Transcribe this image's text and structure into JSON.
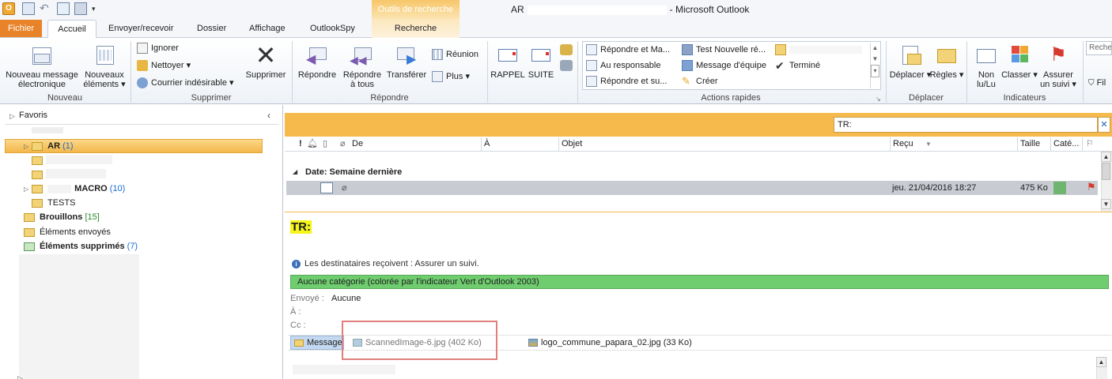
{
  "window": {
    "title_prefix": "AR",
    "title_suffix": "- Microsoft Outlook",
    "contextual_tab_group": "Outils de recherche"
  },
  "tabs": {
    "fichier": "Fichier",
    "accueil": "Accueil",
    "envoyer_recevoir": "Envoyer/recevoir",
    "dossier": "Dossier",
    "affichage": "Affichage",
    "outlookspy": "OutlookSpy",
    "recherche": "Recherche"
  },
  "ribbon": {
    "nouveau": {
      "label": "Nouveau",
      "new_email_l1": "Nouveau message",
      "new_email_l2": "électronique",
      "new_items_l1": "Nouveaux",
      "new_items_l2": "éléments ▾"
    },
    "supprimer": {
      "label": "Supprimer",
      "ignorer": "Ignorer",
      "nettoyer": "Nettoyer ▾",
      "courrier_indesirable": "Courrier indésirable ▾",
      "supprimer": "Supprimer"
    },
    "repondre": {
      "label": "Répondre",
      "repondre": "Répondre",
      "repondre_tous_l1": "Répondre",
      "repondre_tous_l2": "à tous",
      "transferer": "Transférer",
      "reunion": "Réunion",
      "plus": "Plus ▾"
    },
    "custom": {
      "rappel": "RAPPEL",
      "suite": "SUITE"
    },
    "actions_rapides": {
      "label": "Actions rapides",
      "items": [
        "Répondre et Ma...",
        "Au responsable",
        "Répondre et su...",
        "Test Nouvelle ré...",
        "Message d'équipe",
        "Créer",
        "Terminé"
      ]
    },
    "deplacer": {
      "label": "Déplacer",
      "deplacer": "Déplacer ▾",
      "regles": "Règles ▾"
    },
    "indicateurs": {
      "label": "Indicateurs",
      "non_lu_l1": "Non",
      "non_lu_l2": "lu/Lu",
      "classer": "Classer ▾",
      "assurer_l1": "Assurer",
      "assurer_l2": "un suivi ▾"
    },
    "rechercher_partial": "Reche",
    "filtrer_partial": "Fil"
  },
  "nav": {
    "favoris": "Favoris",
    "folders": [
      {
        "name": "AR",
        "count": "(1)"
      },
      {
        "name": "MACRO",
        "count": "(10)"
      },
      {
        "name": "TESTS",
        "count": ""
      },
      {
        "name": "Brouillons",
        "count": "[15]"
      },
      {
        "name": "Éléments envoyés",
        "count": ""
      },
      {
        "name": "Éléments supprimés",
        "count": "(7)"
      }
    ]
  },
  "search": {
    "value": "TR:",
    "clear": "✕"
  },
  "columns": {
    "de": "De",
    "a": "À",
    "objet": "Objet",
    "recu": "Reçu",
    "taille": "Taille",
    "categories": "Caté..."
  },
  "list": {
    "group_header": "Date: Semaine dernière",
    "row": {
      "received": "jeu. 21/04/2016 18:27",
      "size": "475 Ko"
    }
  },
  "reading": {
    "subject": "TR:",
    "info": "Les destinataires reçoivent : Assurer un suivi.",
    "category": "Aucune catégorie (colorée par l'indicateur Vert d'Outlook 2003)",
    "sent_label": "Envoyé :",
    "sent_value": "Aucune",
    "to_label": "À :",
    "cc_label": "Cc :",
    "message_tab": "Message",
    "attachments": [
      "ScannedImage-6.jpg (402 Ko)",
      "logo_commune_papara_02.jpg (33 Ko)"
    ]
  },
  "colors": {
    "accent_orange": "#f6b94c",
    "file_tab": "#e8832a",
    "category_green": "#6fcd6f",
    "selected_folder": "#f5c65b",
    "highlight": "#e17f7f"
  }
}
